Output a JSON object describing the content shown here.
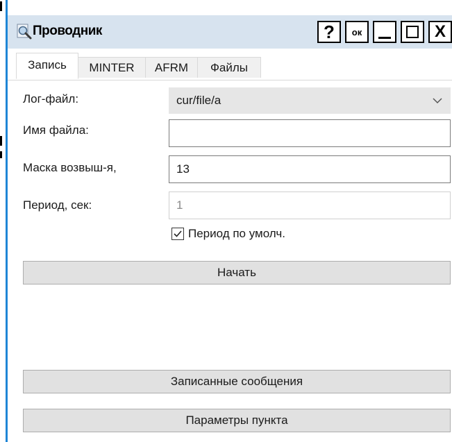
{
  "window": {
    "title": "Проводник",
    "buttons": {
      "help": "?",
      "ok": "ок",
      "close": "X"
    }
  },
  "tabs": [
    {
      "label": "Запись",
      "active": true
    },
    {
      "label": "MINTER",
      "active": false
    },
    {
      "label": "AFRM",
      "active": false
    },
    {
      "label": "Файлы",
      "active": false
    }
  ],
  "form": {
    "log_file": {
      "label": "Лог-файл:",
      "value": "cur/file/a"
    },
    "file_name": {
      "label": "Имя файла:",
      "value": ""
    },
    "mask": {
      "label": "Маска возвыш-я,",
      "value": "13"
    },
    "period": {
      "label": "Период, сек:",
      "value": "1"
    },
    "default_period": {
      "label": "Период по умолч.",
      "checked": true
    }
  },
  "actions": {
    "start": "Начать",
    "recorded_messages": "Записанные сообщения",
    "point_params": "Параметры пункта"
  },
  "colors": {
    "title_bar": "#d7e3ef",
    "window_border": "#1e86d6",
    "button_face": "#e1e1e1"
  }
}
